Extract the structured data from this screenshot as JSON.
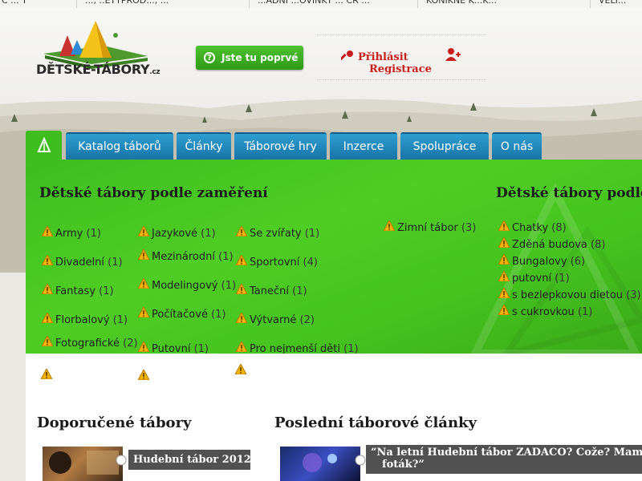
{
  "ticker": [
    "Č ... T",
    "..., ..ĚTYPROD..., ...",
    "...ÁDNÍ ...OVINKY ... ČR ...",
    "KONÍKNE K...K...",
    "VELÍ..."
  ],
  "logo": {
    "name": "DĚTSKÉ-TÁBORY",
    "tld": ".cz"
  },
  "header": {
    "first_visit": "Jste tu poprvé",
    "login": "Přihlásit",
    "register": "Registrace"
  },
  "nav": {
    "tabs": [
      {
        "label": "Katalog táborů"
      },
      {
        "label": "Články"
      },
      {
        "label": "Táborové hry"
      },
      {
        "label": "Inzerce"
      },
      {
        "label": "Spolupráce"
      },
      {
        "label": "O nás"
      }
    ]
  },
  "focus": {
    "title": "Dětské tábory podle zaměření",
    "items": [
      {
        "name": "Army",
        "count": "(1)"
      },
      {
        "name": "Divadelní",
        "count": "(1)"
      },
      {
        "name": "Fantasy",
        "count": "(1)"
      },
      {
        "name": "Florbalový",
        "count": "(1)"
      },
      {
        "name": "Fotografické",
        "count": "(2)"
      },
      {
        "name": "Jazykové",
        "count": "(1)"
      },
      {
        "name": "Mezinárodní",
        "count": "(1)"
      },
      {
        "name": "Modelingový",
        "count": "(1)"
      },
      {
        "name": "Počítačové",
        "count": "(1)"
      },
      {
        "name": "Putovní",
        "count": "(1)"
      },
      {
        "name": "Se zvířaty",
        "count": "(1)"
      },
      {
        "name": "Sportovní",
        "count": "(4)"
      },
      {
        "name": "Taneční",
        "count": "(1)"
      },
      {
        "name": "Výtvarné",
        "count": "(2)"
      },
      {
        "name": "Pro nejmenší děti",
        "count": "(1)"
      },
      {
        "name": "Zimní tábor",
        "count": "(3)"
      }
    ]
  },
  "lodging": {
    "title": "Dětské tábory podle ubytování",
    "items": [
      {
        "name": "Chatky",
        "count": "(8)"
      },
      {
        "name": "Zděná budova",
        "count": "(8)"
      },
      {
        "name": "Bungalovy",
        "count": "(6)"
      },
      {
        "name": "putovní",
        "count": "(1)"
      },
      {
        "name": "s bezlepkovou dietou",
        "count": "(3)"
      },
      {
        "name": "s cukrovkou",
        "count": "(1)"
      }
    ]
  },
  "recommended": {
    "title": "Doporučené tábory",
    "first": "Hudební tábor 2012"
  },
  "articles": {
    "title": "Poslední táborové články",
    "first_line1": "“Na letní Hudební tábor ZADACO? Cože? Mam",
    "first_line2": "foták?”"
  },
  "colors": {
    "accent_green": "#3fbd1e",
    "tab_blue": "#1f86bd",
    "link_red": "#c81e1e"
  }
}
